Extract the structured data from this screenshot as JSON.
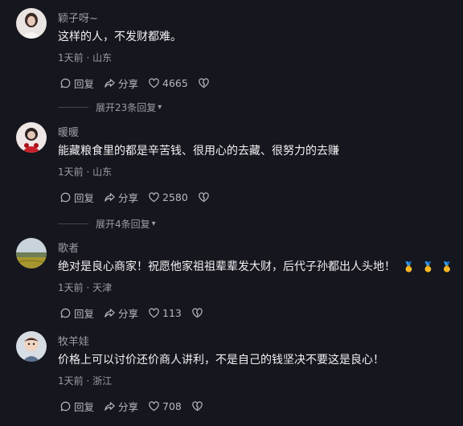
{
  "comments": [
    {
      "username": "颖子呀~",
      "text": "这样的人，不发财都难。",
      "meta": "1天前 · 山东",
      "reply_label": "回复",
      "share_label": "分享",
      "likes": "4665",
      "replies_toggle": "展开23条回复"
    },
    {
      "username": "暖暖",
      "text": "能藏粮食里的都是辛苦钱、很用心的去藏、很努力的去赚",
      "meta": "1天前 · 山东",
      "reply_label": "回复",
      "share_label": "分享",
      "likes": "2580",
      "replies_toggle": "展开4条回复"
    },
    {
      "username": "歌者",
      "text": "绝对是良心商家！祝愿他家祖祖辈辈发大财，后代子孙都出人头地！",
      "medals": [
        "🥇",
        "🥇",
        "🥇"
      ],
      "meta": "1天前 · 天津",
      "reply_label": "回复",
      "share_label": "分享",
      "likes": "113"
    },
    {
      "username": "牧羊娃",
      "text": "价格上可以讨价还价商人讲利，不是自己的钱坚决不要这是良心！",
      "meta": "1天前 · 浙江",
      "reply_label": "回复",
      "share_label": "分享",
      "likes": "708"
    }
  ],
  "colors": {
    "background": "#16161e",
    "primary_text": "#f1f1f3",
    "secondary_text": "#9c9ca6"
  },
  "icons": [
    "reply-icon",
    "share-icon",
    "like-heart-icon",
    "dislike-broken-heart-icon",
    "chevron-down-icon"
  ]
}
